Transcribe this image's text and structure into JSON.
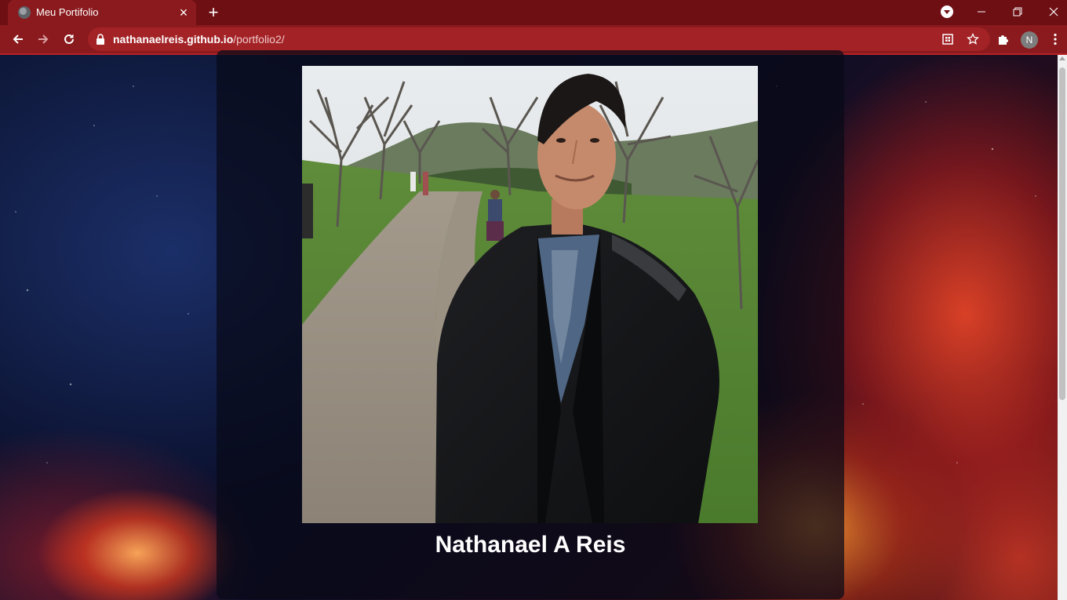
{
  "browser": {
    "tab_title": "Meu Portifolio",
    "url_host": "nathanaelreis.github.io",
    "url_path": "/portfolio2/",
    "profile_initial": "N",
    "accent_color": "#8a1a1d"
  },
  "icons": {
    "tab_favicon": "globe-icon",
    "tab_close": "close-icon",
    "new_tab": "plus-icon",
    "back": "arrow-left-icon",
    "forward": "arrow-right-icon",
    "reload": "reload-icon",
    "lock": "lock-icon",
    "install": "install-app-icon",
    "bookmark": "star-icon",
    "extensions": "puzzle-icon",
    "menu": "kebab-menu-icon"
  },
  "page": {
    "profile_name": "Nathanael A Reis"
  }
}
